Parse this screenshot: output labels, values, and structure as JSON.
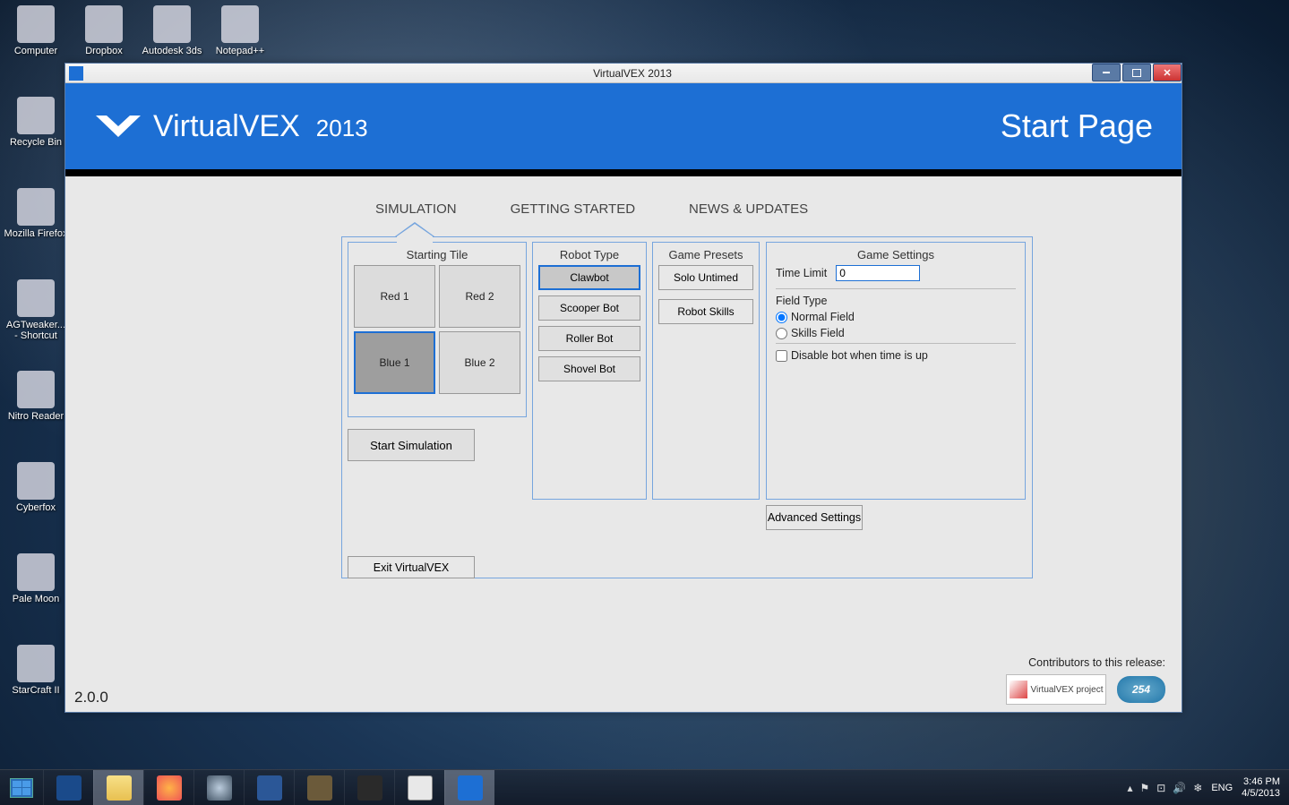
{
  "window": {
    "title": "VirtualVEX 2013"
  },
  "header": {
    "app_name": "VirtualVEX",
    "app_year": "2013",
    "page_title": "Start Page"
  },
  "tabs": {
    "simulation": "SIMULATION",
    "getting_started": "GETTING STARTED",
    "news": "NEWS & UPDATES"
  },
  "panels": {
    "starting_tile": {
      "title": "Starting Tile",
      "tiles": {
        "red1": "Red 1",
        "red2": "Red 2",
        "blue1": "Blue 1",
        "blue2": "Blue 2"
      }
    },
    "robot_type": {
      "title": "Robot Type",
      "options": {
        "clawbot": "Clawbot",
        "scooper": "Scooper Bot",
        "roller": "Roller Bot",
        "shovel": "Shovel Bot"
      }
    },
    "game_presets": {
      "title": "Game Presets",
      "options": {
        "solo": "Solo Untimed",
        "skills": "Robot Skills"
      }
    },
    "game_settings": {
      "title": "Game Settings",
      "time_limit_label": "Time Limit",
      "time_limit_value": "0",
      "field_type_label": "Field Type",
      "radio_normal": "Normal Field",
      "radio_skills": "Skills Field",
      "disable_label": "Disable bot when time is up"
    }
  },
  "buttons": {
    "start_sim": "Start Simulation",
    "advanced": "Advanced Settings",
    "exit": "Exit VirtualVEX"
  },
  "footer": {
    "version": "2.0.0",
    "contributors": "Contributors to this release:",
    "logo1_text": "VirtualVEX project",
    "logo2_text": "254"
  },
  "desktop_icons": {
    "computer": "Computer",
    "dropbox": "Dropbox",
    "autodesk": "Autodesk 3ds",
    "notepadpp": "Notepad++",
    "recycle": "Recycle Bin",
    "firefox": "Mozilla Firefox",
    "agtweaker": "AGTweaker... - Shortcut",
    "nitro": "Nitro Reader",
    "cyberfox": "Cyberfox",
    "palemoon": "Pale Moon",
    "starcraft": "StarCraft II"
  },
  "systray": {
    "lang": "ENG",
    "time": "3:46 PM",
    "date": "4/5/2013"
  }
}
